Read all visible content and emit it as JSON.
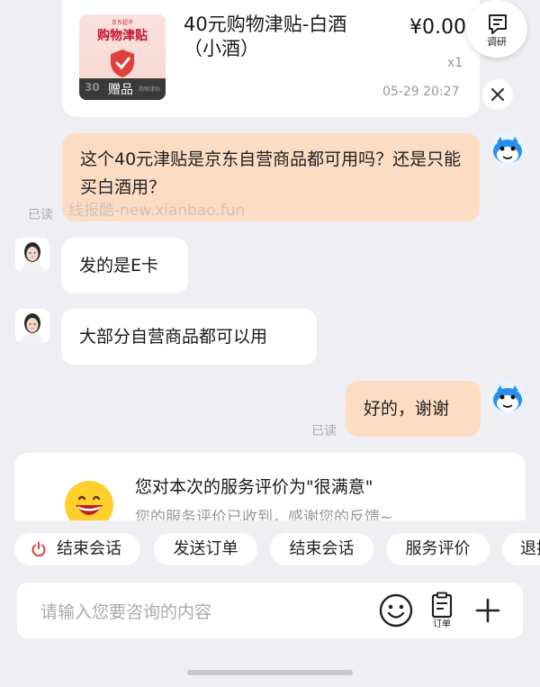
{
  "product": {
    "thumb_brand": "京东超市",
    "thumb_title": "购物津贴",
    "thumb_number": "30",
    "thumb_gift": "赠品",
    "thumb_small": "购物津贴",
    "name": "40元购物津贴-白酒（小酒）",
    "price": "¥0.00",
    "quantity": "x1",
    "time": "05-29 20:27"
  },
  "survey_button": {
    "label": "调研",
    "icon": "survey-icon"
  },
  "close_button": {
    "icon": "close-icon"
  },
  "messages": [
    {
      "from": "user",
      "text": "这个40元津贴是京东自营商品都可用吗？还是只能买白酒用？",
      "status": "已读"
    },
    {
      "from": "agent",
      "text": "发的是E卡"
    },
    {
      "from": "agent",
      "text": "大部分自营商品都可以用"
    },
    {
      "from": "user",
      "text": "好的，谢谢",
      "status": "已读"
    }
  ],
  "watermark": "线报酷-new.xianbao.fun",
  "rating": {
    "title": "您对本次的服务评价为\"很满意\"",
    "subtitle": "您的服务评价已收到，感谢您的反馈~"
  },
  "quick_actions": [
    {
      "label": "结束会话",
      "icon": "power-icon"
    },
    {
      "label": "发送订单"
    },
    {
      "label": "结束会话"
    },
    {
      "label": "服务评价"
    },
    {
      "label": "退换"
    }
  ],
  "input": {
    "placeholder": "请输入您要咨询的内容",
    "order_label": "订单"
  },
  "colors": {
    "user_bubble": "#fddcc4",
    "agent_bubble": "#ffffff",
    "background": "#efeff3",
    "accent_red": "#e0403a"
  }
}
